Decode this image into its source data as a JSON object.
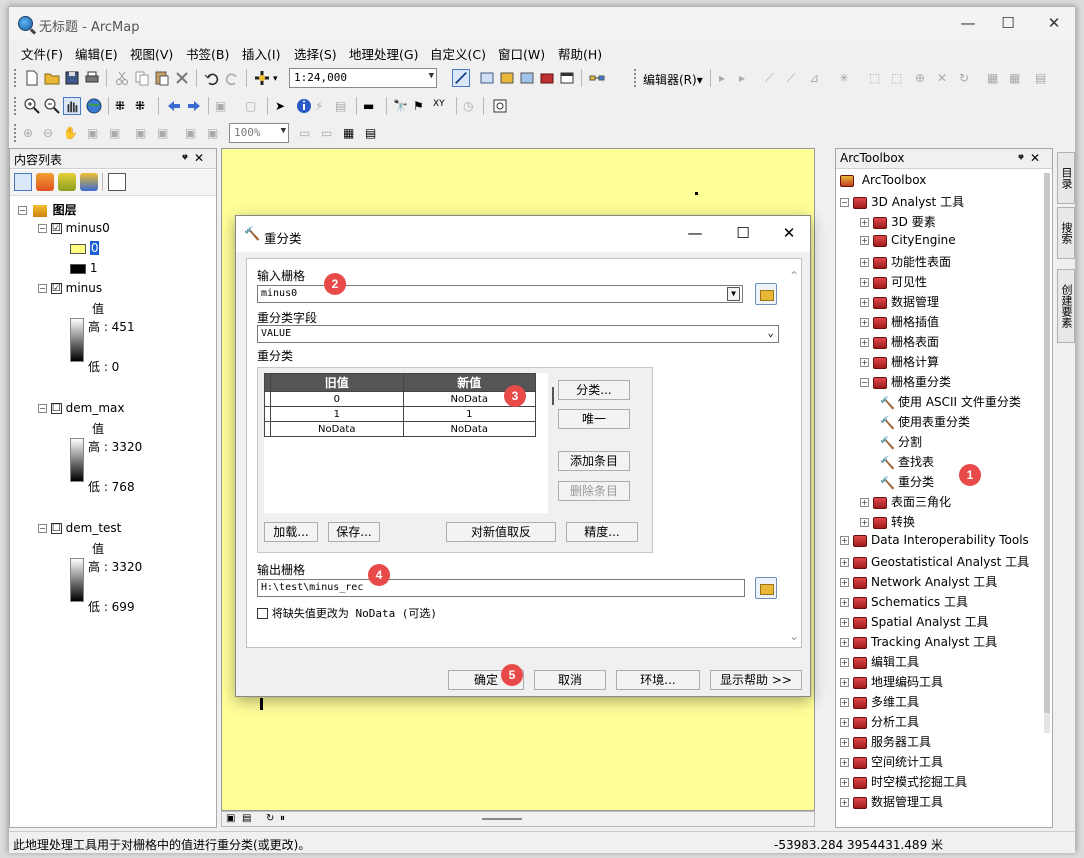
{
  "app": {
    "title": "无标题 - ArcMap",
    "window_buttons": [
      "—",
      "☐",
      "✕"
    ]
  },
  "menu": [
    "文件(F)",
    "编辑(E)",
    "视图(V)",
    "书签(B)",
    "插入(I)",
    "选择(S)",
    "地理处理(G)",
    "自定义(C)",
    "窗口(W)",
    "帮助(H)"
  ],
  "toolbar": {
    "scale": "1:24,000",
    "editor_label": "编辑器(R)▾",
    "zoom_percent": "100%"
  },
  "toc": {
    "title": "内容列表",
    "root": "图层",
    "layers": [
      {
        "name": "minus0",
        "checked": "☑",
        "class0": "0",
        "class1": "1"
      },
      {
        "name": "minus",
        "checked": "☑",
        "value_label": "值",
        "high": "高 : 451",
        "low": "低 : 0"
      },
      {
        "name": "dem_max",
        "checked": "☐",
        "value_label": "值",
        "high": "高 : 3320",
        "low": "低 : 768"
      },
      {
        "name": "dem_test",
        "checked": "☐",
        "value_label": "值",
        "high": "高 : 3320",
        "low": "低 : 699"
      }
    ]
  },
  "toolbox": {
    "title": "ArcToolbox",
    "root": "ArcToolbox",
    "items": [
      {
        "label": "3D Analyst 工具",
        "level": 1,
        "exp": "⊟"
      },
      {
        "label": "3D 要素",
        "level": 2,
        "exp": "⊞"
      },
      {
        "label": "CityEngine",
        "level": 2,
        "exp": "⊞"
      },
      {
        "label": "功能性表面",
        "level": 2,
        "exp": "⊞"
      },
      {
        "label": "可见性",
        "level": 2,
        "exp": "⊞"
      },
      {
        "label": "数据管理",
        "level": 2,
        "exp": "⊞"
      },
      {
        "label": "栅格插值",
        "level": 2,
        "exp": "⊞"
      },
      {
        "label": "栅格表面",
        "level": 2,
        "exp": "⊞"
      },
      {
        "label": "栅格计算",
        "level": 2,
        "exp": "⊞"
      },
      {
        "label": "栅格重分类",
        "level": 2,
        "exp": "⊟"
      },
      {
        "label": "使用 ASCII 文件重分类",
        "level": 3,
        "exp": ""
      },
      {
        "label": "使用表重分类",
        "level": 3,
        "exp": ""
      },
      {
        "label": "分割",
        "level": 3,
        "exp": ""
      },
      {
        "label": "查找表",
        "level": 3,
        "exp": ""
      },
      {
        "label": "重分类",
        "level": 3,
        "exp": ""
      },
      {
        "label": "表面三角化",
        "level": 2,
        "exp": "⊞"
      },
      {
        "label": "转换",
        "level": 2,
        "exp": "⊞"
      },
      {
        "label": "Data Interoperability Tools",
        "level": 1,
        "exp": "⊞"
      },
      {
        "label": "Geostatistical Analyst 工具",
        "level": 1,
        "exp": "⊞"
      },
      {
        "label": "Network Analyst 工具",
        "level": 1,
        "exp": "⊞"
      },
      {
        "label": "Schematics 工具",
        "level": 1,
        "exp": "⊞"
      },
      {
        "label": "Spatial Analyst 工具",
        "level": 1,
        "exp": "⊞"
      },
      {
        "label": "Tracking Analyst 工具",
        "level": 1,
        "exp": "⊞"
      },
      {
        "label": "编辑工具",
        "level": 1,
        "exp": "⊞"
      },
      {
        "label": "地理编码工具",
        "level": 1,
        "exp": "⊞"
      },
      {
        "label": "多维工具",
        "level": 1,
        "exp": "⊞"
      },
      {
        "label": "分析工具",
        "level": 1,
        "exp": "⊞"
      },
      {
        "label": "服务器工具",
        "level": 1,
        "exp": "⊞"
      },
      {
        "label": "空间统计工具",
        "level": 1,
        "exp": "⊞"
      },
      {
        "label": "时空模式挖掘工具",
        "level": 1,
        "exp": "⊞"
      },
      {
        "label": "数据管理工具",
        "level": 1,
        "exp": "⊞"
      }
    ]
  },
  "side_tabs": [
    "目录",
    "搜索",
    "创建要素"
  ],
  "dialog": {
    "title": "重分类",
    "input_raster_label": "输入栅格",
    "input_raster_value": "minus0",
    "reclass_field_label": "重分类字段",
    "reclass_field_value": "VALUE",
    "reclass_label": "重分类",
    "table_headers": [
      "旧值",
      "新值"
    ],
    "table_rows": [
      {
        "old": "0",
        "new": "NoData"
      },
      {
        "old": "1",
        "new": "1"
      },
      {
        "old": "NoData",
        "new": "NoData"
      }
    ],
    "buttons_right": [
      "分类...",
      "唯一",
      "添加条目",
      "删除条目"
    ],
    "buttons_bottom": [
      "加载...",
      "保存...",
      "对新值取反",
      "精度..."
    ],
    "output_raster_label": "输出栅格",
    "output_raster_value": "H:\\test\\minus_rec",
    "nodata_checkbox": "将缺失值更改为 NoData (可选)",
    "footer_buttons": [
      "确定",
      "取消",
      "环境...",
      "显示帮助 >>"
    ]
  },
  "badges": [
    "1",
    "2",
    "3",
    "4",
    "5"
  ],
  "status": {
    "message": "此地理处理工具用于对栅格中的值进行重分类(或更改)。",
    "coordinates": "-53983.284  3954431.489 米"
  },
  "colors": {
    "map_background": "#ffff99",
    "badge": "#e84a4a"
  }
}
